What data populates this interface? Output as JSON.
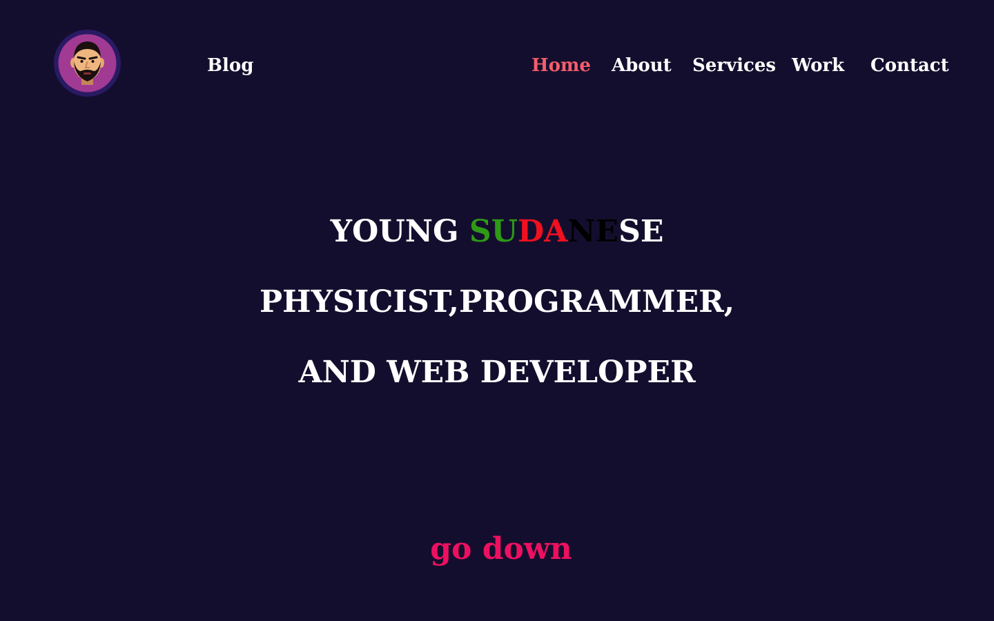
{
  "colors": {
    "background": "#140e2e",
    "nav_text": "#ffffff",
    "nav_active": "#f45d6b",
    "accent_green": "#2e9a16",
    "accent_red": "#f01020",
    "accent_black": "#000000",
    "go_down": "#ee1060"
  },
  "header": {
    "avatar_icon": "bearded-man-avatar-icon",
    "nav_left": [
      {
        "label": "Blog"
      }
    ],
    "nav_right": [
      {
        "label": "Home",
        "active": true
      },
      {
        "label": "About"
      },
      {
        "label": "Services"
      },
      {
        "label": "Work"
      },
      {
        "label": "Contact"
      }
    ]
  },
  "hero": {
    "line1_prefix": "YOUNG ",
    "line1_word": {
      "green": "SU",
      "red": "DA",
      "black": "NE",
      "white": "SE"
    },
    "line2": "PHYSICIST,PROGRAMMER,",
    "line3": "AND WEB DEVELOPER"
  },
  "scroll_link": {
    "label": "go down"
  }
}
